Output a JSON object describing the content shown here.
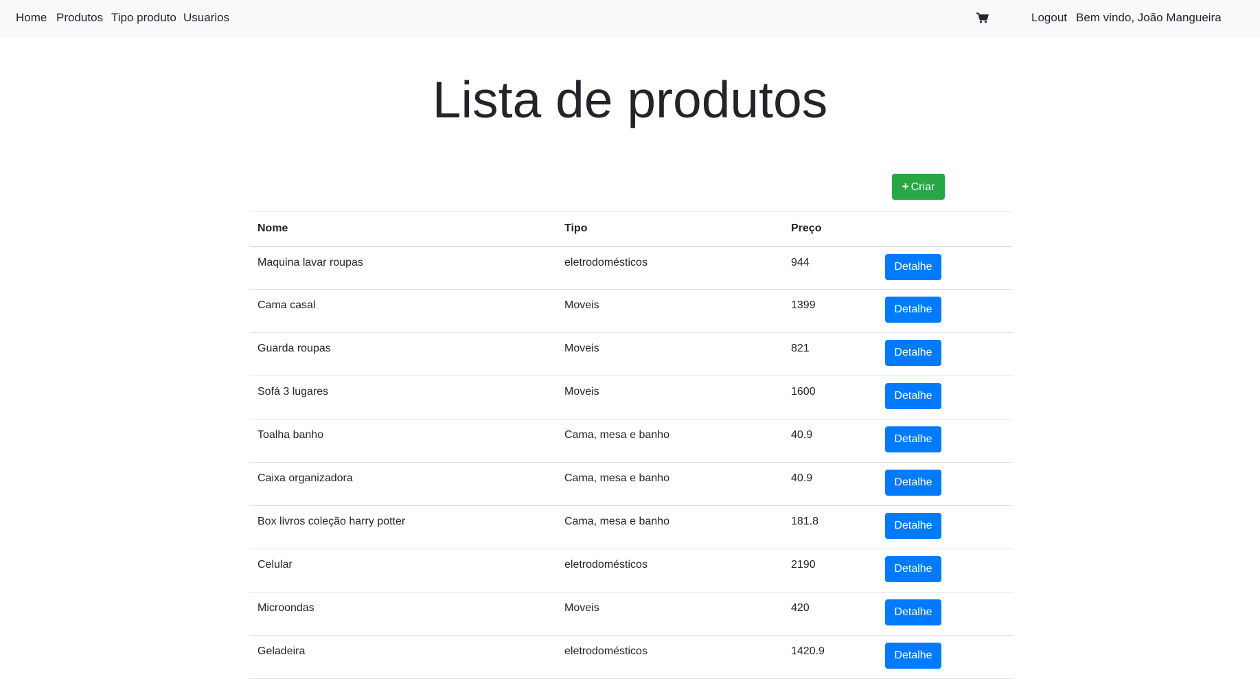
{
  "nav": {
    "home": "Home",
    "produtos": "Produtos",
    "tipo_produto": "Tipo produto",
    "usuarios": "Usuarios",
    "logout": "Logout",
    "welcome": "Bem vindo, João Mangueira",
    "cart_icon": "shopping-cart-icon"
  },
  "page": {
    "title": "Lista de produtos",
    "create_label": "Criar",
    "create_icon": "+"
  },
  "table": {
    "headers": {
      "nome": "Nome",
      "tipo": "Tipo",
      "preco": "Preço"
    },
    "rows": [
      {
        "nome": "Maquina lavar roupas",
        "tipo": "eletrodomésticos",
        "preco": "944",
        "action": "Detalhe"
      },
      {
        "nome": "Cama casal",
        "tipo": "Moveis",
        "preco": "1399",
        "action": "Detalhe"
      },
      {
        "nome": "Guarda roupas",
        "tipo": "Moveis",
        "preco": "821",
        "action": "Detalhe"
      },
      {
        "nome": "Sofá 3 lugares",
        "tipo": "Moveis",
        "preco": "1600",
        "action": "Detalhe"
      },
      {
        "nome": "Toalha banho",
        "tipo": "Cama, mesa e banho",
        "preco": "40.9",
        "action": "Detalhe"
      },
      {
        "nome": "Caixa organizadora",
        "tipo": "Cama, mesa e banho",
        "preco": "40.9",
        "action": "Detalhe"
      },
      {
        "nome": "Box livros coleção harry potter",
        "tipo": "Cama, mesa e banho",
        "preco": "181.8",
        "action": "Detalhe"
      },
      {
        "nome": "Celular",
        "tipo": "eletrodomésticos",
        "preco": "2190",
        "action": "Detalhe"
      },
      {
        "nome": "Microondas",
        "tipo": "Moveis",
        "preco": "420",
        "action": "Detalhe"
      },
      {
        "nome": "Geladeira",
        "tipo": "eletrodomésticos",
        "preco": "1420.9",
        "action": "Detalhe"
      }
    ]
  },
  "colors": {
    "navbar_bg": "#f8f9fa",
    "create_button": "#28a745",
    "detail_button": "#007bff",
    "text": "#212529"
  }
}
